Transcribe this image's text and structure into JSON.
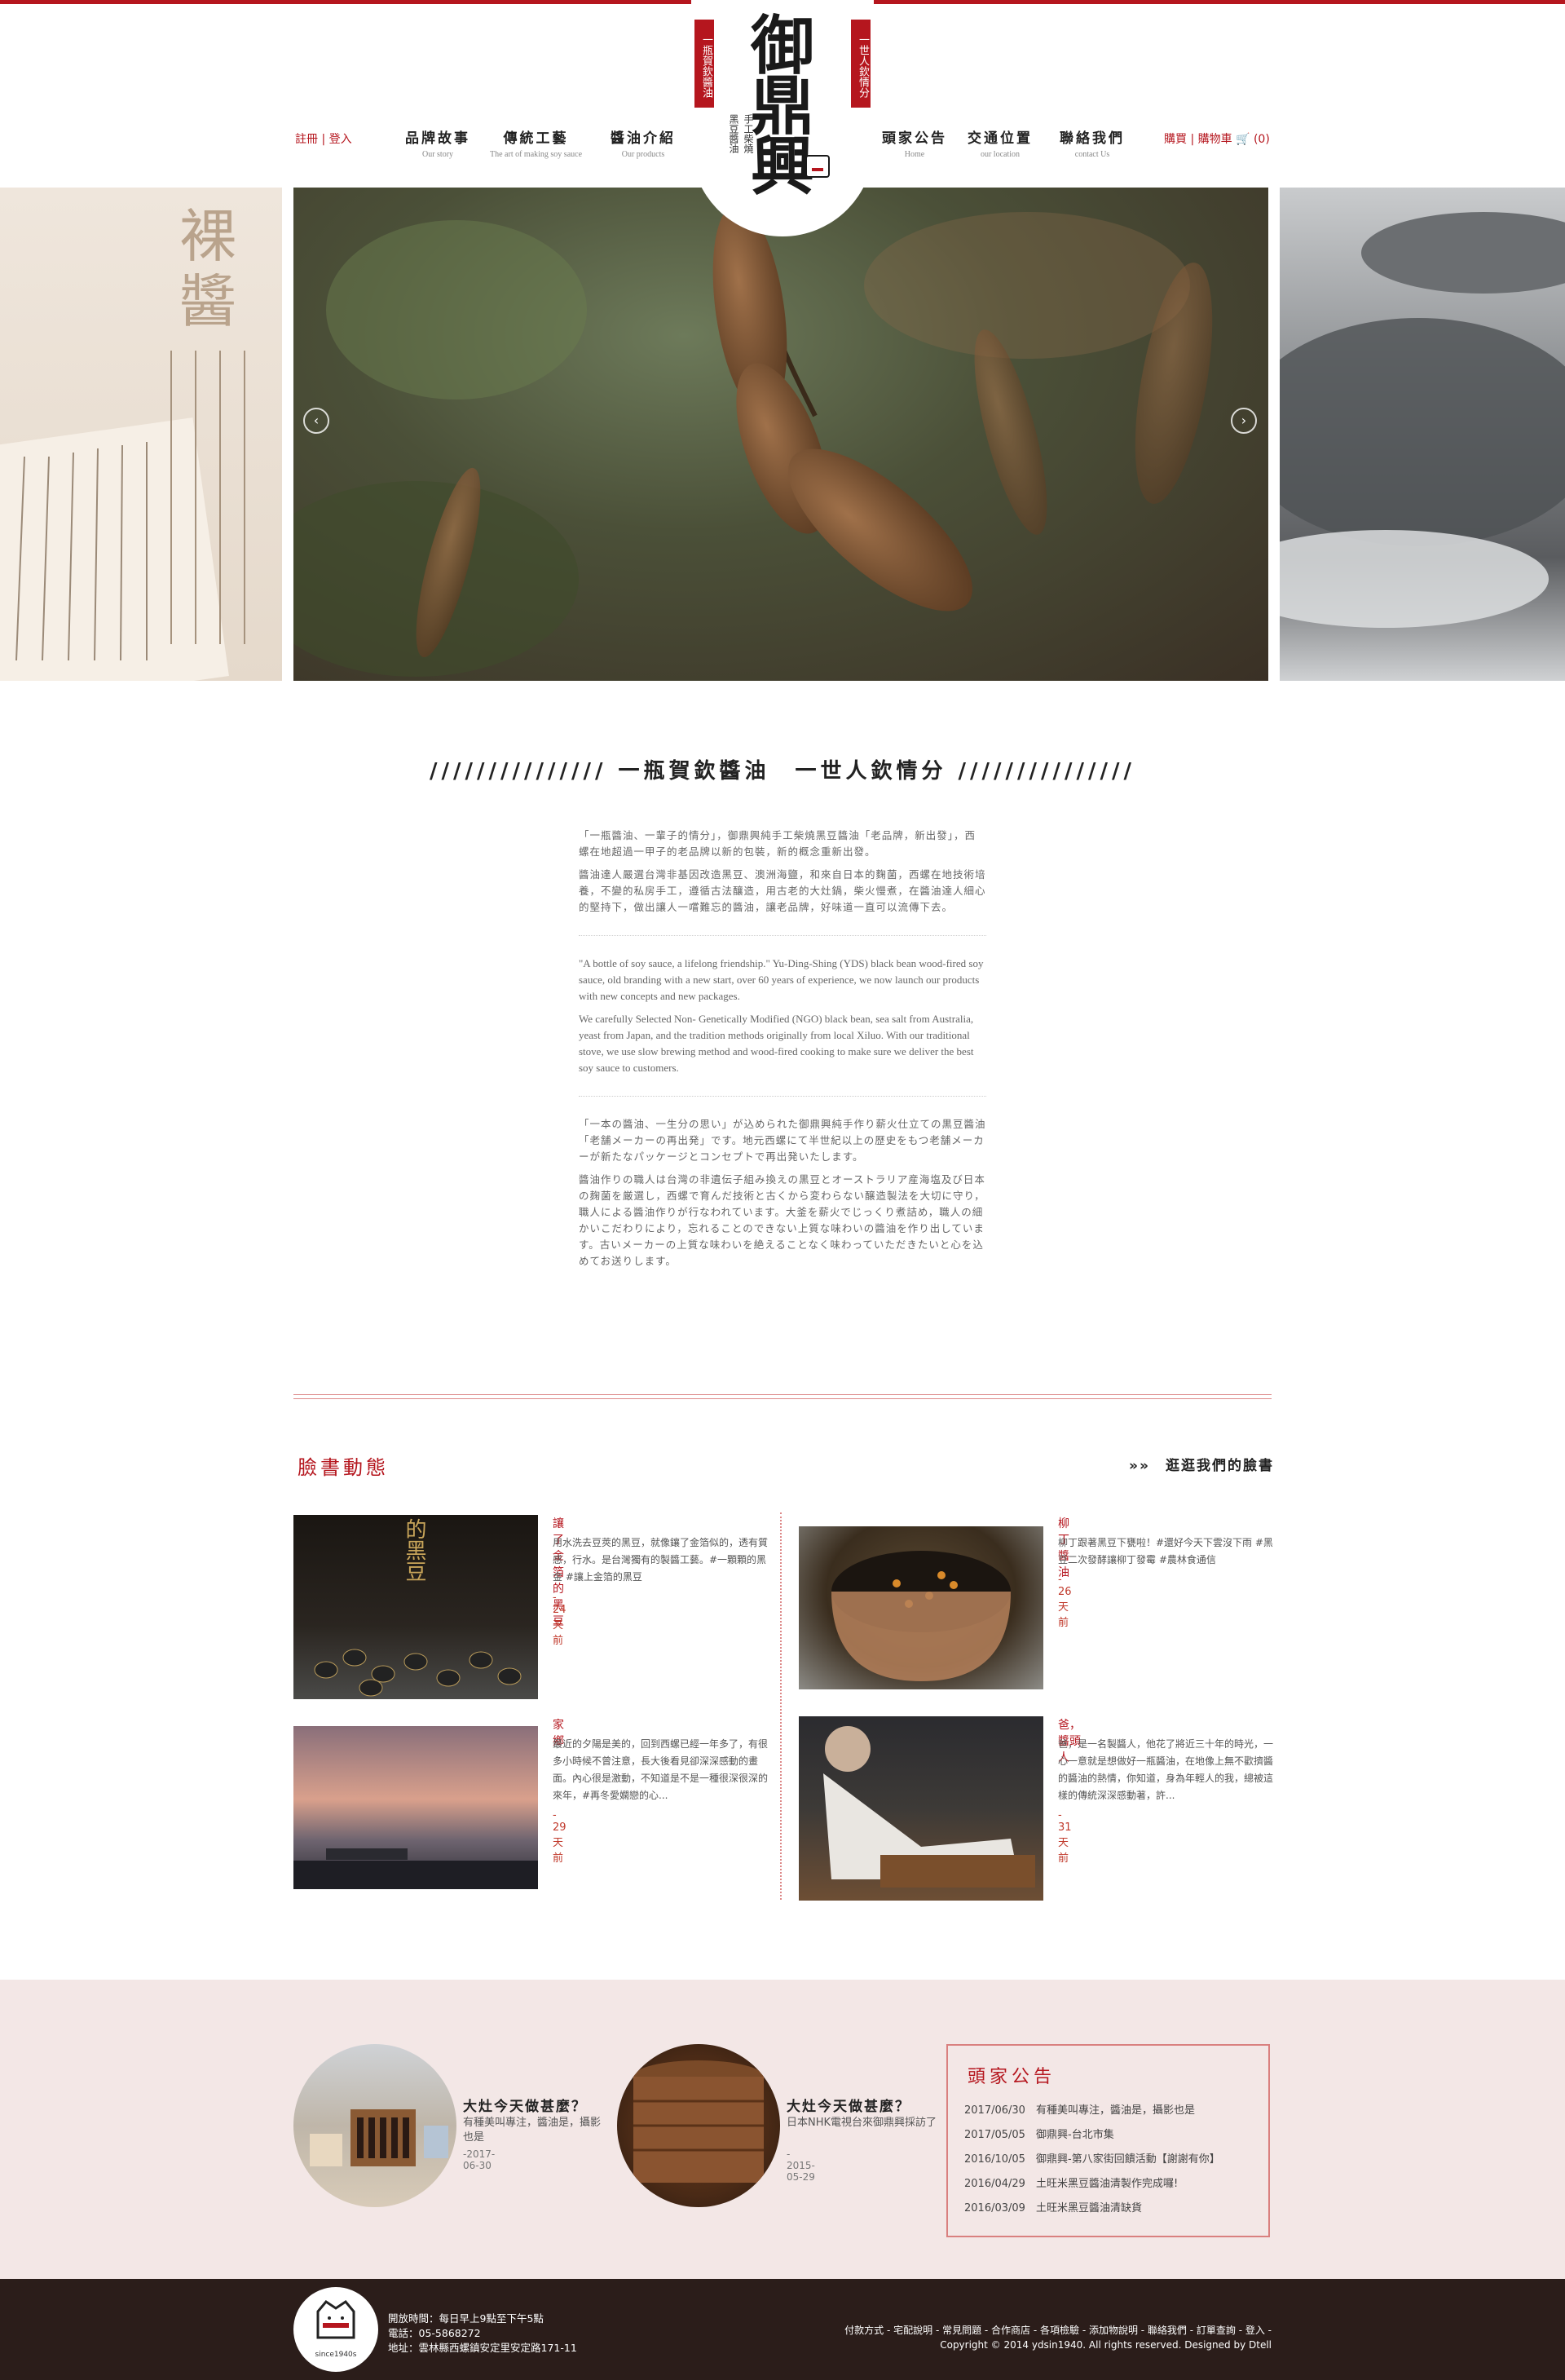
{
  "header": {
    "auth": {
      "register": "註冊",
      "sep": "|",
      "login": "登入"
    },
    "nav_left": [
      {
        "cn": "品牌故事",
        "en": "Our story"
      },
      {
        "cn": "傳統工藝",
        "en": "The art of making soy sauce"
      },
      {
        "cn": "醬油介紹",
        "en": "Our products"
      }
    ],
    "nav_right": [
      {
        "cn": "頭家公告",
        "en": "Home"
      },
      {
        "cn": "交通位置",
        "en": "our location"
      },
      {
        "cn": "聯絡我們",
        "en": "contact Us"
      }
    ],
    "cart": {
      "buy": "購買",
      "sep": "|",
      "cart_label": "購物車",
      "count": "(0)"
    },
    "logo": {
      "main": "御鼎興",
      "banner_left": "一瓶賀欽醬油",
      "banner_right": "一世人欽情分",
      "sub1": "手工柴燒",
      "sub2": "黑豆醬油"
    }
  },
  "slider": {
    "left_text": "裸醬",
    "prev": "‹",
    "next": "›"
  },
  "intro": {
    "title": "/////////////// 一瓶賀欽醬油　一世人欽情分 ///////////////",
    "zh": [
      "「一瓶醬油、一輩子的情分」，御鼎興純手工柴燒黑豆醬油「老品牌，新出發」，西螺在地超過一甲子的老品牌以新的包裝，新的概念重新出發。",
      "醬油達人嚴選台灣非基因改造黑豆、澳洲海鹽，和來自日本的麴菌，西螺在地技術培養，不變的私房手工，遵循古法釀造，用古老的大灶鍋，柴火慢煮，在醬油達人細心的堅持下，做出讓人一嚐難忘的醬油，讓老品牌，好味道一直可以流傳下去。"
    ],
    "en": [
      "\"A bottle of soy sauce, a lifelong friendship.\" Yu-Ding-Shing (YDS) black bean wood-fired soy sauce, old branding with a new start, over 60 years of experience, we now launch our products with new concepts and new packages.",
      "We carefully Selected Non- Genetically Modified (NGO) black bean, sea salt from Australia, yeast from Japan, and the tradition methods originally from local Xiluo. With our traditional stove, we use slow brewing method and wood-fired cooking to make sure we deliver the best soy sauce to customers."
    ],
    "jp": [
      "「一本の醬油、一生分の思い」が込められた御鼎興純手作り薪火仕立ての黒豆醬油「老舗メーカーの再出発」です。地元西螺にて半世紀以上の歴史をもつ老舗メーカーが新たなパッケージとコンセプトで再出発いたします。",
      "醬油作りの職人は台灣の非遺伝子組み換えの黒豆とオーストラリア産海塩及び日本の麹菌を厳選し，西螺で育んだ技術と古くから変わらない醸造製法を大切に守り，職人による醬油作りが行なわれています。大釜を薪火でじっくり煮詰め，職人の細かいこだわりにより，忘れることのできない上質な味わいの醬油を作り出しています。古いメーカーの上質な味わいを絶えることなく味わっていただきたいと心を込めてお送りします。"
    ]
  },
  "facebook": {
    "title": "臉書動態",
    "link": "»»　逛逛我們的臉書",
    "posts": [
      {
        "title": "讓了金箔的黑豆",
        "text": "用水洗去豆莢的黑豆，就像鑲了金箔似的，透有質感，行水。是台灣獨有的製醬工藝。#一顆顆的黑金 #讓上金箔的黑豆",
        "time": "- 24天前",
        "img_text": "的黑豆"
      },
      {
        "title": "柳丁醬油",
        "text": "柳丁跟著黑豆下甕啦！#還好今天下雲沒下雨 #黑豆二次發酵讓柳丁發霉 #農林食通信",
        "time": "- 26天前"
      },
      {
        "title": "家鄉",
        "text": "最近的夕陽是美的，回到西螺已經一年多了，有很多小時候不曾注意，長大後看見卻深深感動的畫面。內心很是激動，不知道是不是一種很深很深的來年，#再冬愛嫻戀的心...",
        "time": "- 29天前"
      },
      {
        "title": "爸，醬頭人",
        "text": "爸，是一名製醬人，他花了將近三十年的時光，一心一意就是想做好一瓶醬油，在地像上無不歡擠醬的醬油的熱情，你知道，身為年輕人的我，總被這樣的傳統深深感動著，許...",
        "time": "- 31天前"
      }
    ]
  },
  "pink": {
    "items": [
      {
        "title": "大灶今天做甚麼？",
        "text": "有種美叫專注，醬油是，攝影也是",
        "date": "-2017-06-30"
      },
      {
        "title": "大灶今天做甚麼？",
        "text": "日本NHK電視台來御鼎興採訪了",
        "date": "- 2015-05-29"
      }
    ],
    "news": {
      "title": "頭家公告",
      "items": [
        {
          "date": "2017/06/30",
          "text": "有種美叫專注，醬油是，攝影也是"
        },
        {
          "date": "2017/05/05",
          "text": "御鼎興-台北市集"
        },
        {
          "date": "2016/10/05",
          "text": "御鼎興-第八家街回饋活動【謝謝有你】"
        },
        {
          "date": "2016/04/29",
          "text": "土旺米黑豆醬油清製作完成囉!"
        },
        {
          "date": "2016/03/09",
          "text": "土旺米黑豆醬油清缺貨"
        }
      ]
    }
  },
  "footer": {
    "logo_caption": "since1940s",
    "hours": "開放時間：每日早上9點至下午5點",
    "phone": "電話：05-5868272",
    "address": "地址：雲林縣西螺鎮安定里安定路171-11",
    "links": "付款方式 - 宅配說明 - 常見問題 - 合作商店 - 各項檢驗 - 添加物說明 - 聯絡我們 - 訂單查詢 - 登入 -",
    "copyright": "Copyright © 2014 ydsin1940. All rights reserved. Designed by Dtell"
  },
  "colors": {
    "accent": "#b5161e",
    "pink_bg": "#f3e7e6",
    "footer_bg": "#2b1d1a"
  }
}
